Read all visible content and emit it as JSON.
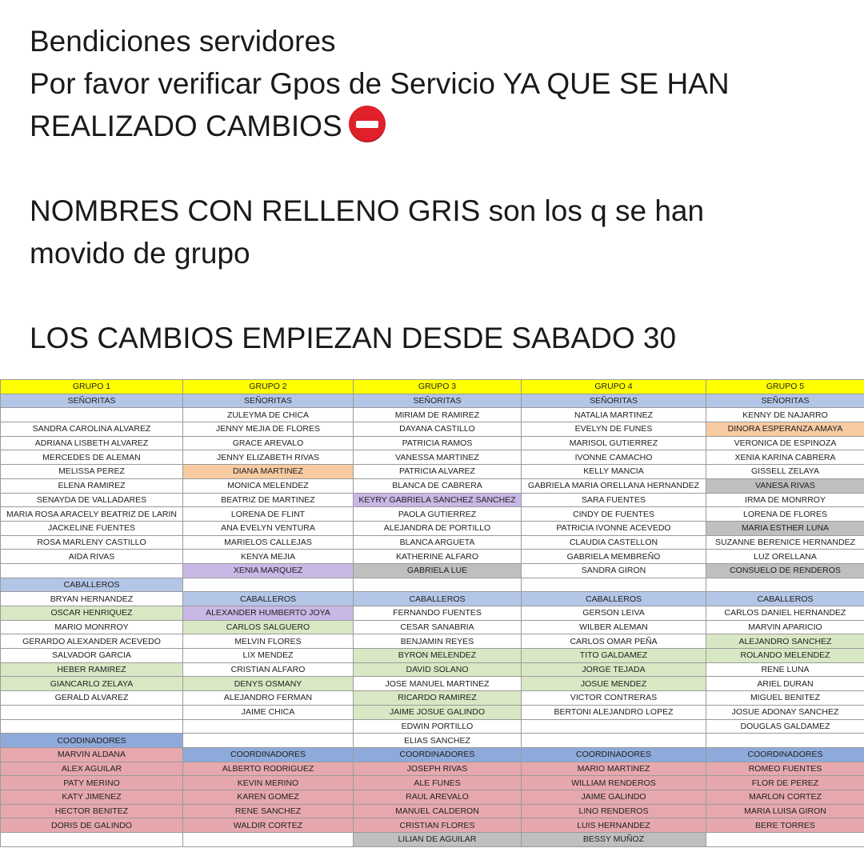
{
  "message": {
    "line1": "Bendiciones servidores",
    "line2": "Por favor verificar Gpos de Servicio YA QUE SE HAN",
    "line3": "REALIZADO CAMBIOS",
    "line4": "NOMBRES CON RELLENO GRIS son los q se han",
    "line5": "movido de grupo",
    "line6": "LOS CAMBIOS EMPIEZAN DESDE SABADO 30"
  },
  "table": {
    "colors": {
      "yellow": "#ffff00",
      "blue": "#b4c6e7",
      "coord": "#8eaadb",
      "red": "#e6a8ad",
      "green": "#d9e8c4",
      "gray": "#bfbfbf",
      "orange": "#f8cba3",
      "purple": "#c9b8e6"
    },
    "rows": [
      [
        [
          "GRUPO 1",
          "yellow"
        ],
        [
          "GRUPO 2",
          "yellow"
        ],
        [
          "GRUPO 3",
          "yellow"
        ],
        [
          "GRUPO 4",
          "yellow"
        ],
        [
          "GRUPO 5",
          "yellow"
        ]
      ],
      [
        [
          "SEÑORITAS",
          "blue"
        ],
        [
          "SEÑORITAS",
          "blue"
        ],
        [
          "SEÑORITAS",
          "blue"
        ],
        [
          "SEÑORITAS",
          "blue"
        ],
        [
          "SEÑORITAS",
          "blue"
        ]
      ],
      [
        [
          "",
          ""
        ],
        [
          "ZULEYMA DE CHICA",
          ""
        ],
        [
          "MIRIAM DE RAMIREZ",
          ""
        ],
        [
          "NATALIA MARTINEZ",
          ""
        ],
        [
          "KENNY DE NAJARRO",
          ""
        ]
      ],
      [
        [
          "SANDRA CAROLINA ALVAREZ",
          ""
        ],
        [
          "JENNY MEJIA DE FLORES",
          ""
        ],
        [
          "DAYANA CASTILLO",
          ""
        ],
        [
          "EVELYN DE FUNES",
          ""
        ],
        [
          "DINORA ESPERANZA AMAYA",
          "orange"
        ]
      ],
      [
        [
          "ADRIANA LISBETH ALVAREZ",
          ""
        ],
        [
          "GRACE AREVALO",
          ""
        ],
        [
          "PATRICIA RAMOS",
          ""
        ],
        [
          "MARISOL GUTIERREZ",
          ""
        ],
        [
          "VERONICA DE ESPINOZA",
          ""
        ]
      ],
      [
        [
          "MERCEDES DE ALEMAN",
          ""
        ],
        [
          "JENNY ELIZABETH RIVAS",
          ""
        ],
        [
          "VANESSA MARTINEZ",
          ""
        ],
        [
          "IVONNE CAMACHO",
          ""
        ],
        [
          "XENIA KARINA CABRERA",
          ""
        ]
      ],
      [
        [
          "MELISSA PEREZ",
          ""
        ],
        [
          "DIANA MARTINEZ",
          "orange"
        ],
        [
          "PATRICIA ALVAREZ",
          ""
        ],
        [
          "KELLY MANCIA",
          ""
        ],
        [
          "GISSELL ZELAYA",
          ""
        ]
      ],
      [
        [
          "ELENA RAMIREZ",
          ""
        ],
        [
          "MONICA MELENDEZ",
          ""
        ],
        [
          "BLANCA DE CABRERA",
          ""
        ],
        [
          "GABRIELA MARIA ORELLANA HERNANDEZ",
          ""
        ],
        [
          "VANESA RIVAS",
          "gray"
        ]
      ],
      [
        [
          "SENAYDA DE VALLADARES",
          ""
        ],
        [
          "BEATRIZ DE MARTINEZ",
          ""
        ],
        [
          "KEYRY GABRIELA SANCHEZ SANCHEZ",
          "purple"
        ],
        [
          "SARA FUENTES",
          ""
        ],
        [
          "IRMA DE MONRROY",
          ""
        ]
      ],
      [
        [
          "MARIA ROSA ARACELY BEATRIZ DE LARIN",
          ""
        ],
        [
          "LORENA DE FLINT",
          ""
        ],
        [
          "PAOLA GUTIERREZ",
          ""
        ],
        [
          "CINDY DE FUENTES",
          ""
        ],
        [
          "LORENA DE FLORES",
          ""
        ]
      ],
      [
        [
          "JACKELINE FUENTES",
          ""
        ],
        [
          "ANA EVELYN VENTURA",
          ""
        ],
        [
          "ALEJANDRA DE PORTILLO",
          ""
        ],
        [
          "PATRICIA IVONNE ACEVEDO",
          ""
        ],
        [
          "MARIA ESTHER LUNA",
          "gray"
        ]
      ],
      [
        [
          "ROSA MARLENY CASTILLO",
          ""
        ],
        [
          "MARIELOS CALLEJAS",
          ""
        ],
        [
          "BLANCA ARGUETA",
          ""
        ],
        [
          "CLAUDIA CASTELLON",
          ""
        ],
        [
          "SUZANNE BERENICE HERNANDEZ",
          ""
        ]
      ],
      [
        [
          "AIDA RIVAS",
          ""
        ],
        [
          "KENYA MEJIA",
          ""
        ],
        [
          "KATHERINE ALFARO",
          ""
        ],
        [
          "GABRIELA MEMBREÑO",
          ""
        ],
        [
          "LUZ ORELLANA",
          ""
        ]
      ],
      [
        [
          "",
          ""
        ],
        [
          "XENIA MARQUEZ",
          "purple"
        ],
        [
          "GABRIELA LUE",
          "gray"
        ],
        [
          "SANDRA GIRON",
          ""
        ],
        [
          "CONSUELO DE RENDEROS",
          "gray"
        ]
      ],
      [
        [
          "CABALLEROS",
          "blue"
        ],
        [
          "",
          ""
        ],
        [
          "",
          ""
        ],
        [
          "",
          ""
        ],
        [
          "",
          ""
        ]
      ],
      [
        [
          "BRYAN HERNANDEZ",
          ""
        ],
        [
          "CABALLEROS",
          "blue"
        ],
        [
          "CABALLEROS",
          "blue"
        ],
        [
          "CABALLEROS",
          "blue"
        ],
        [
          "CABALLEROS",
          "blue"
        ]
      ],
      [
        [
          "OSCAR HENRIQUEZ",
          "green"
        ],
        [
          "ALEXANDER HUMBERTO JOYA",
          "purple"
        ],
        [
          "FERNANDO FUENTES",
          ""
        ],
        [
          "GERSON LEIVA",
          ""
        ],
        [
          "CARLOS DANIEL HERNANDEZ",
          ""
        ]
      ],
      [
        [
          "MARIO MONRROY",
          ""
        ],
        [
          "CARLOS SALGUERO",
          "green"
        ],
        [
          "CESAR SANABRIA",
          ""
        ],
        [
          "WILBER ALEMAN",
          ""
        ],
        [
          "MARVIN APARICIO",
          ""
        ]
      ],
      [
        [
          "GERARDO ALEXANDER ACEVEDO",
          ""
        ],
        [
          "MELVIN FLORES",
          ""
        ],
        [
          "BENJAMIN REYES",
          ""
        ],
        [
          "CARLOS OMAR PEÑA",
          ""
        ],
        [
          "ALEJANDRO SANCHEZ",
          "green"
        ]
      ],
      [
        [
          "SALVADOR GARCIA",
          ""
        ],
        [
          "LIX MENDEZ",
          ""
        ],
        [
          "BYRON MELENDEZ",
          "green"
        ],
        [
          "TITO GALDAMEZ",
          "green"
        ],
        [
          "ROLANDO MELENDEZ",
          "green"
        ]
      ],
      [
        [
          "HEBER RAMIREZ",
          "green"
        ],
        [
          "CRISTIAN ALFARO",
          ""
        ],
        [
          "DAVID SOLANO",
          "green"
        ],
        [
          "JORGE TEJADA",
          "green"
        ],
        [
          "RENE LUNA",
          ""
        ]
      ],
      [
        [
          "GIANCARLO ZELAYA",
          "green"
        ],
        [
          "DENYS OSMANY",
          "green"
        ],
        [
          "JOSE MANUEL MARTINEZ",
          ""
        ],
        [
          "JOSUE MENDEZ",
          "green"
        ],
        [
          "ARIEL DURAN",
          ""
        ]
      ],
      [
        [
          "GERALD ALVAREZ",
          ""
        ],
        [
          "ALEJANDRO FERMAN",
          ""
        ],
        [
          "RICARDO RAMIREZ",
          "green"
        ],
        [
          "VICTOR CONTRERAS",
          ""
        ],
        [
          "MIGUEL BENITEZ",
          ""
        ]
      ],
      [
        [
          "",
          ""
        ],
        [
          "JAIME CHICA",
          ""
        ],
        [
          "JAIME JOSUE GALINDO",
          "green"
        ],
        [
          "BERTONI ALEJANDRO LOPEZ",
          ""
        ],
        [
          "JOSUE ADONAY SANCHEZ",
          ""
        ]
      ],
      [
        [
          "",
          ""
        ],
        [
          "",
          ""
        ],
        [
          "EDWIN PORTILLO",
          ""
        ],
        [
          "",
          ""
        ],
        [
          "DOUGLAS GALDAMEZ",
          ""
        ]
      ],
      [
        [
          "COODINADORES",
          "coord"
        ],
        [
          "",
          ""
        ],
        [
          "ELIAS SANCHEZ",
          ""
        ],
        [
          "",
          ""
        ],
        [
          "",
          ""
        ]
      ],
      [
        [
          "MARVIN ALDANA",
          "red"
        ],
        [
          "COORDINADORES",
          "coord"
        ],
        [
          "COORDINADORES",
          "coord"
        ],
        [
          "COORDINADORES",
          "coord"
        ],
        [
          "COORDINADORES",
          "coord"
        ]
      ],
      [
        [
          "ALEX AGUILAR",
          "red"
        ],
        [
          "ALBERTO RODRIGUEZ",
          "red"
        ],
        [
          "JOSEPH RIVAS",
          "red"
        ],
        [
          "MARIO MARTINEZ",
          "red"
        ],
        [
          "ROMEO FUENTES",
          "red"
        ]
      ],
      [
        [
          "PATY MERINO",
          "red"
        ],
        [
          "KEVIN MERINO",
          "red"
        ],
        [
          "ALE FUNES",
          "red"
        ],
        [
          "WILLIAM RENDEROS",
          "red"
        ],
        [
          "FLOR DE PEREZ",
          "red"
        ]
      ],
      [
        [
          "KATY JIMENEZ",
          "red"
        ],
        [
          "KAREN GOMEZ",
          "red"
        ],
        [
          "RAUL AREVALO",
          "red"
        ],
        [
          "JAIME GALINDO",
          "red"
        ],
        [
          "MARLON CORTEZ",
          "red"
        ]
      ],
      [
        [
          "HECTOR BENITEZ",
          "red"
        ],
        [
          "RENE SANCHEZ",
          "red"
        ],
        [
          "MANUEL CALDERON",
          "red"
        ],
        [
          "LINO RENDEROS",
          "red"
        ],
        [
          "MARIA LUISA GIRON",
          "red"
        ]
      ],
      [
        [
          "DORIS DE GALINDO",
          "red"
        ],
        [
          "WALDIR CORTEZ",
          "red"
        ],
        [
          "CRISTIAN FLORES",
          "red"
        ],
        [
          "LUIS HERNANDEZ",
          "red"
        ],
        [
          "BERE TORRES",
          "red"
        ]
      ],
      [
        [
          "",
          ""
        ],
        [
          "",
          ""
        ],
        [
          "LILIAN DE AGUILAR",
          "gray"
        ],
        [
          "BESSY MUÑOZ",
          "gray"
        ],
        [
          "",
          ""
        ]
      ]
    ]
  }
}
